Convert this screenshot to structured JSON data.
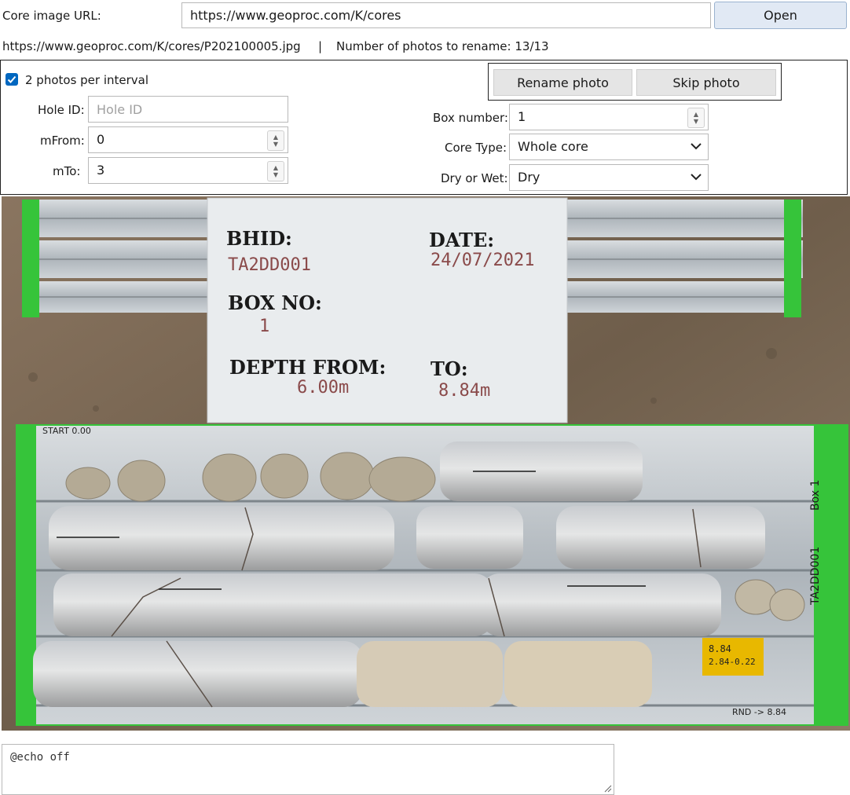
{
  "url_row": {
    "label": "Core image URL:",
    "value": "https://www.geoproc.com/K/cores",
    "open_label": "Open"
  },
  "status": {
    "current_file": "https://www.geoproc.com/K/cores/P202100005.jpg",
    "separator": "|",
    "count_text": "Number of photos to rename: 13/13"
  },
  "form": {
    "two_photos_label": "2 photos per interval",
    "two_photos_checked": true,
    "hole_id": {
      "label": "Hole ID:",
      "value": "",
      "placeholder": "Hole ID"
    },
    "m_from": {
      "label": "mFrom:",
      "value": "0"
    },
    "m_to": {
      "label": "mTo:",
      "value": "3"
    },
    "box_number": {
      "label": "Box number:",
      "value": "1"
    },
    "core_type": {
      "label": "Core Type:",
      "value": "Whole core"
    },
    "dry_wet": {
      "label": "Dry or Wet:",
      "value": "Dry"
    },
    "rename_label": "Rename photo",
    "skip_label": "Skip photo"
  },
  "photo_card": {
    "bhid_label": "BHID:",
    "bhid_value": "TA2DD001",
    "date_label": "DATE:",
    "date_value": "24/07/2021",
    "box_label": "BOX NO:",
    "box_value": "1",
    "from_label": "DEPTH FROM:",
    "from_value": "6.00m",
    "to_label": "TO:",
    "to_value": "8.84m"
  },
  "photo_tray": {
    "box_marker": "Box 1",
    "hole_marker": "TA2DD001",
    "tag_line1": "8.84",
    "tag_line2": "2.84-0.22",
    "end_marker": "RND -> 8.84",
    "start_marker": "START 0.00"
  },
  "log": {
    "text": "@echo off"
  },
  "colors": {
    "accent": "#0067c0",
    "tray_green": "#36c43a",
    "soil": "#7d6a55"
  }
}
